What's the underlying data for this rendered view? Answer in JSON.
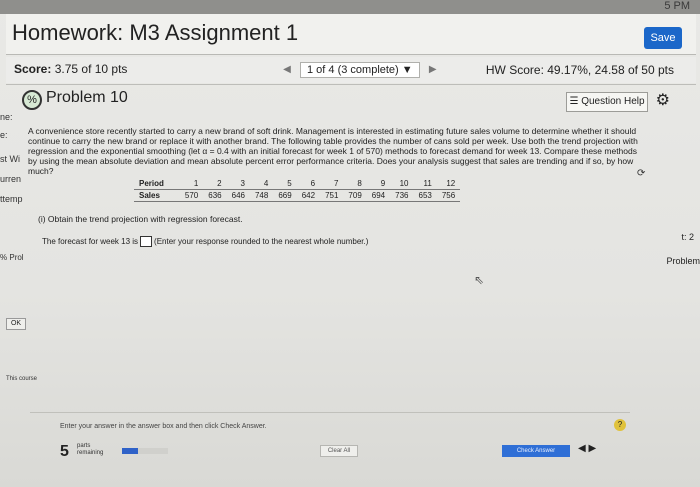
{
  "browser": {
    "corner_text": "5 PM"
  },
  "header": {
    "title": "Homework: M3 Assignment 1",
    "save_label": "Save"
  },
  "scorebar": {
    "score_label": "Score:",
    "score_value": "3.75 of 10 pts",
    "pager_text": "1 of 4 (3 complete)",
    "hw_score": "HW Score: 49.17%, 24.58 of 50 pts"
  },
  "problem": {
    "title": "Problem 10",
    "question_help": "Question Help"
  },
  "left_strip": [
    "ne:",
    "e:",
    "st Wi",
    "urren",
    "ttemp"
  ],
  "question": {
    "text": "A convenience store recently started to carry a new brand of soft drink. Management is interested in estimating future sales volume to determine whether it should continue to carry the new brand or replace it with another brand. The following table provides the number of cans sold per week. Use both the trend projection with regression and the exponential smoothing (let α = 0.4 with an initial forecast for week 1 of 570) methods to forecast demand for week 13. Compare these methods by using the mean absolute deviation and mean absolute percent error performance criteria. Does your analysis suggest that sales are trending and if so, by how much?"
  },
  "table": {
    "row_labels": [
      "Period",
      "Sales"
    ],
    "periods": [
      "1",
      "2",
      "3",
      "4",
      "5",
      "6",
      "7",
      "8",
      "9",
      "10",
      "11",
      "12"
    ],
    "sales": [
      "570",
      "636",
      "646",
      "748",
      "669",
      "642",
      "751",
      "709",
      "694",
      "736",
      "653",
      "756"
    ]
  },
  "part_i": "(i) Obtain the trend projection with regression forecast.",
  "forecast_prefix": "The forecast for week 13 is",
  "forecast_suffix": "(Enter your response rounded to the nearest whole number.)",
  "right_side": {
    "note": "t: 2",
    "problem": "Problem"
  },
  "left_side": {
    "prol": "Prol",
    "ok": "OK",
    "this_course": "This course"
  },
  "bottom": {
    "instruction": "Enter your answer in the answer box and then click Check Answer.",
    "parts_number": "5",
    "parts_label_1": "parts",
    "parts_label_2": "remaining",
    "clear_all": "Clear All",
    "check_answer": "Check Answer",
    "progress_fraction": 0.35
  },
  "colors": {
    "accent": "#1b67c9",
    "help": "#e0c23b"
  },
  "icons": [
    "refresh-icon",
    "gear-icon",
    "help-icon",
    "chevron-left-icon",
    "chevron-right-icon"
  ]
}
